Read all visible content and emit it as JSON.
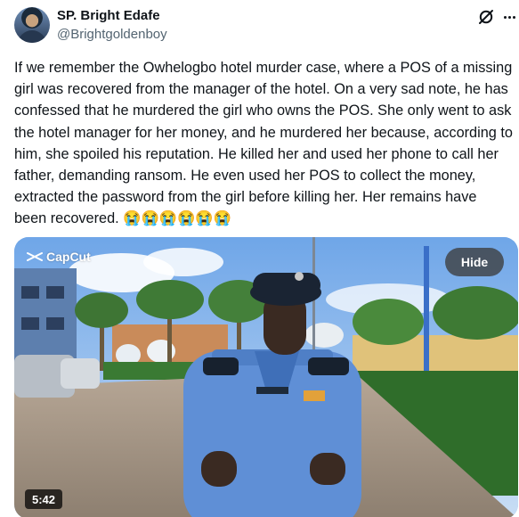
{
  "author": {
    "display_name": "SP. Bright Edafe",
    "handle": "@Brightgoldenboy"
  },
  "tweet": {
    "text": "If we remember the Owhelogbo hotel murder case, where a POS of a missing girl was recovered from the manager of the hotel. On a very sad note, he has confessed that he murdered the girl who owns the POS. She only went to ask the hotel manager for her money, and he murdered her because, according to him, she spoiled his reputation. He killed her and used her phone to call her father, demanding ransom. He even used her POS to collect the money, extracted the password from the girl before killing her. Her remains have been recovered. 😭😭😭😭😭😭"
  },
  "media": {
    "watermark": "CapCut",
    "hide_label": "Hide",
    "duration": "5:42"
  },
  "icons": {
    "grok": "grok-icon",
    "more": "more-options-icon",
    "watermark": "capcut-logo-icon"
  },
  "colors": {
    "text_primary": "#0f1419",
    "text_secondary": "#536471",
    "uniform_blue": "#5f8fd6",
    "beret": "#1a2433"
  }
}
